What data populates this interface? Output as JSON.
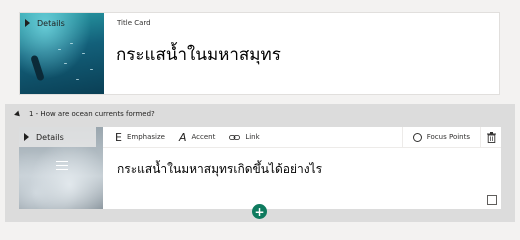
{
  "title_card": {
    "thumb_label": "Details",
    "card_label": "Title Card",
    "title": "กระแสน้ำในมหาสมุทร"
  },
  "question_section": {
    "header": "1 - How are ocean currents formed?",
    "card": {
      "thumb_label": "Details",
      "toolbar": {
        "emphasize": "Emphasize",
        "accent": "Accent",
        "link": "Link",
        "focus_points": "Focus Points"
      },
      "title": "กระแสน้ำในมหาสมุทรเกิดขึ้นได้อย่างไร"
    }
  },
  "icons": {
    "emphasize": "E",
    "accent": "A",
    "add": "+"
  }
}
